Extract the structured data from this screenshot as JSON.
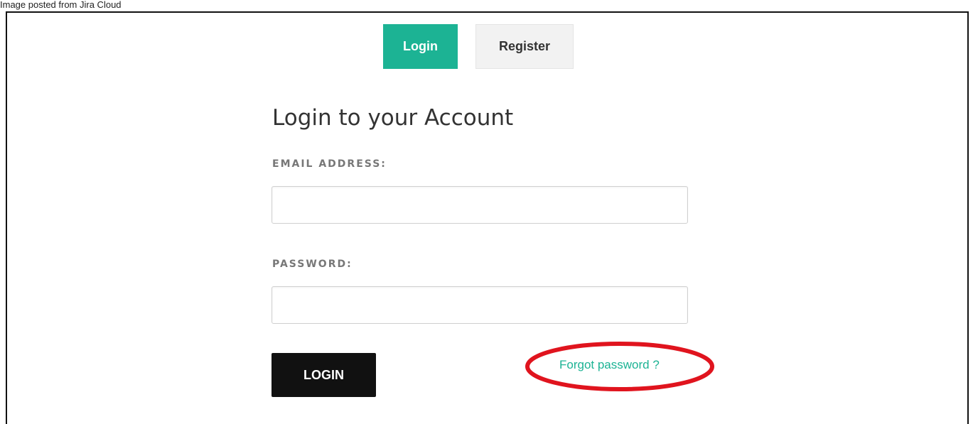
{
  "caption": "Image posted from Jira Cloud",
  "tabs": {
    "login": "Login",
    "register": "Register"
  },
  "form": {
    "title": "Login to your Account",
    "email_label": "EMAIL ADDRESS:",
    "email_value": "",
    "password_label": "PASSWORD:",
    "password_value": "",
    "submit_label": "LOGIN",
    "forgot_label": "Forgot password ?"
  },
  "colors": {
    "accent": "#1cb394",
    "submit_bg": "#111111",
    "annotation": "#e0141e"
  }
}
